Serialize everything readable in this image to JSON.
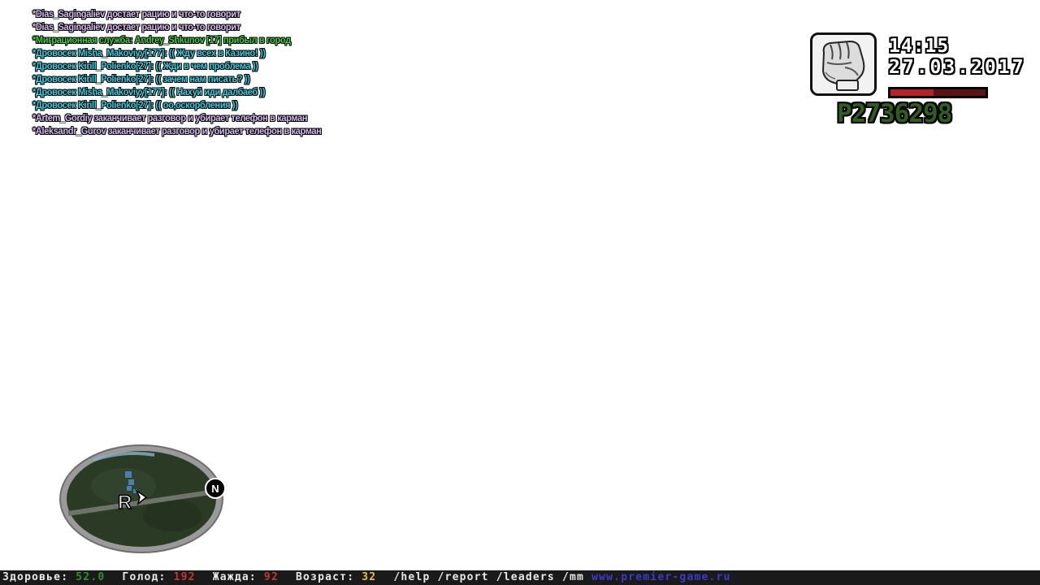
{
  "chat": {
    "lines": [
      {
        "text": "*Dias_Sagingaliev достает рацию и что-то говорит",
        "color": "#d6b8f0"
      },
      {
        "text": "*Dias_Sagingaliev достает рацию и что-то говорит",
        "color": "#d6b8f0"
      },
      {
        "text": "*Миграционная служба: Andrey_Shkunov [17] прибыл в город",
        "color": "#3fd23f"
      },
      {
        "text": "*Дровосек Misha_Makoviyy[177]: (( Жду всех в Казино! ))",
        "color": "#2fd3e6"
      },
      {
        "text": "*Дровосек Kirill_Polienko[27]: (( Жди в чем проблема ))",
        "color": "#2fd3e6"
      },
      {
        "text": "*Дровосек Kirill_Polienko[27]: (( зачем нам писать? ))",
        "color": "#2fd3e6"
      },
      {
        "text": "*Дровосек Misha_Makoviyy[177]: (( Нахуй иди далбаеб ))",
        "color": "#2fd3e6"
      },
      {
        "text": "*Дровосек Kirill_Polienko[27]: (( оо,оскорбления ))",
        "color": "#2fd3e6"
      },
      {
        "text": "*Artem_Gordiy заканчивает разговор и убирает телефон в карман",
        "color": "#d6b8f0"
      },
      {
        "text": "*Aleksandr_Gurov заканчивает разговор и убирает телефон в карман",
        "color": "#d6b8f0"
      }
    ]
  },
  "hud": {
    "weapon_icon": "fist-icon",
    "time": "14:15",
    "date": "27.03.2017",
    "health_fraction": 0.45,
    "health_color": "#b4232a",
    "money": "P2736298",
    "money_color": "#2f5c1f"
  },
  "radar": {
    "north_label": "N",
    "player_marker": "R",
    "map_color": "#2b3a24",
    "ring_color": "#9a9a9a"
  },
  "status_bar": {
    "items": [
      {
        "label": "Здоровье: ",
        "value": "52.0",
        "value_color": "#2e8f2e"
      },
      {
        "label": "Голод: ",
        "value": "192",
        "value_color": "#c0392b"
      },
      {
        "label": "Жажда: ",
        "value": "92",
        "value_color": "#c0392b"
      },
      {
        "label": "Возраст: ",
        "value": "32",
        "value_color": "#e3c04a"
      }
    ],
    "commands": "/help /report /leaders /mm ",
    "website": "www.premier-game.ru",
    "website_color": "#3a3acf"
  }
}
